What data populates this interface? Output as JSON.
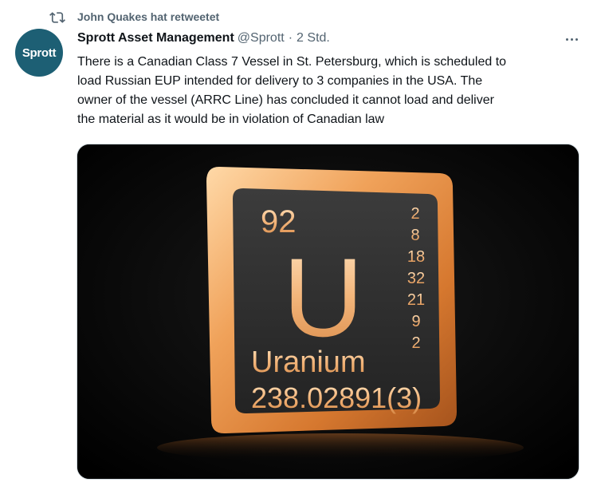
{
  "retweet": {
    "icon": "retweet-icon",
    "text": "John Quakes hat retweetet"
  },
  "tweet": {
    "avatar_text": "Sprott",
    "avatar_color": "#1d5f74",
    "name": "Sprott Asset Management",
    "handle": "@Sprott",
    "separator": "·",
    "time": "2 Std.",
    "more_icon": "more-icon",
    "text_lines": [
      "There is a Canadian Class 7 Vessel in St. Petersburg, which is scheduled to",
      "load Russian EUP intended for delivery to 3 companies in the USA. The",
      "owner of the vessel (ARRC Line) has concluded it cannot load and deliver",
      "the material as it would be in violation of Canadian law"
    ]
  },
  "media": {
    "element": {
      "atomic_number": "92",
      "symbol": "U",
      "name": "Uranium",
      "atomic_mass": "238.02891(3)",
      "electron_shells": [
        "2",
        "8",
        "18",
        "32",
        "21",
        "9",
        "2"
      ]
    }
  }
}
